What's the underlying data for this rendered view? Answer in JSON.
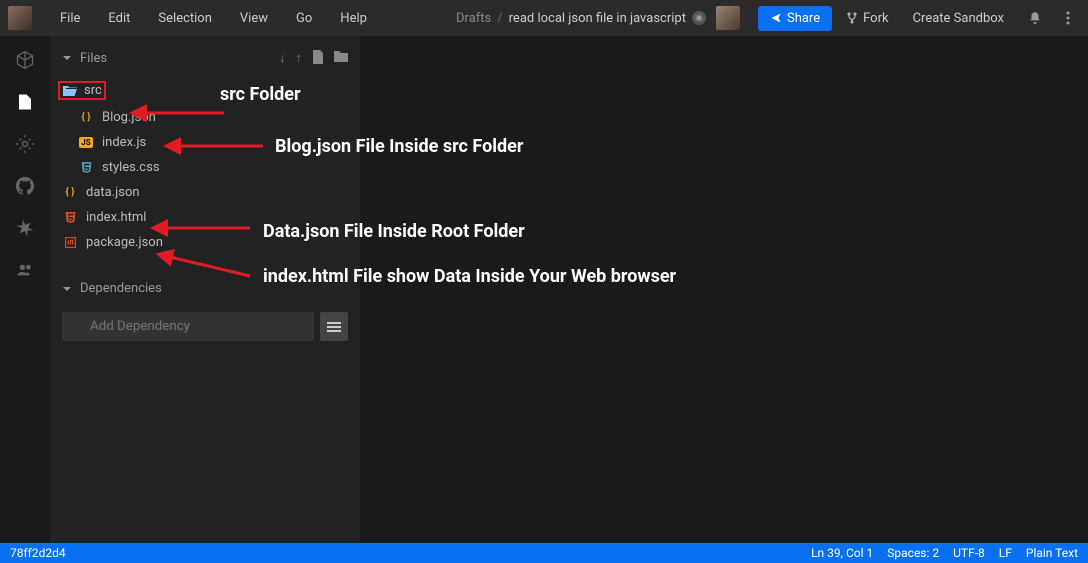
{
  "topbar": {
    "menus": [
      "File",
      "Edit",
      "Selection",
      "View",
      "Go",
      "Help"
    ],
    "breadcrumb_root": "Drafts",
    "breadcrumb_title": "read local json file in javascript",
    "share": "Share",
    "fork": "Fork",
    "create": "Create Sandbox"
  },
  "sidebar": {
    "files_label": "Files",
    "deps_label": "Dependencies",
    "add_dep_placeholder": "Add Dependency",
    "items": {
      "src": "src",
      "blog": "Blog.json",
      "indexjs": "index.js",
      "styles": "styles.css",
      "datajson": "data.json",
      "indexhtml": "index.html",
      "pkg": "package.json"
    }
  },
  "annotations": {
    "a1": "src Folder",
    "a2": "Blog.json File Inside src Folder",
    "a3": "Data.json File Inside Root Folder",
    "a4": "index.html File show Data Inside Your Web browser"
  },
  "status": {
    "commit": "78ff2d2d4",
    "cursor": "Ln 39, Col 1",
    "spaces": "Spaces: 2",
    "encoding": "UTF-8",
    "eol": "LF",
    "lang": "Plain Text"
  }
}
